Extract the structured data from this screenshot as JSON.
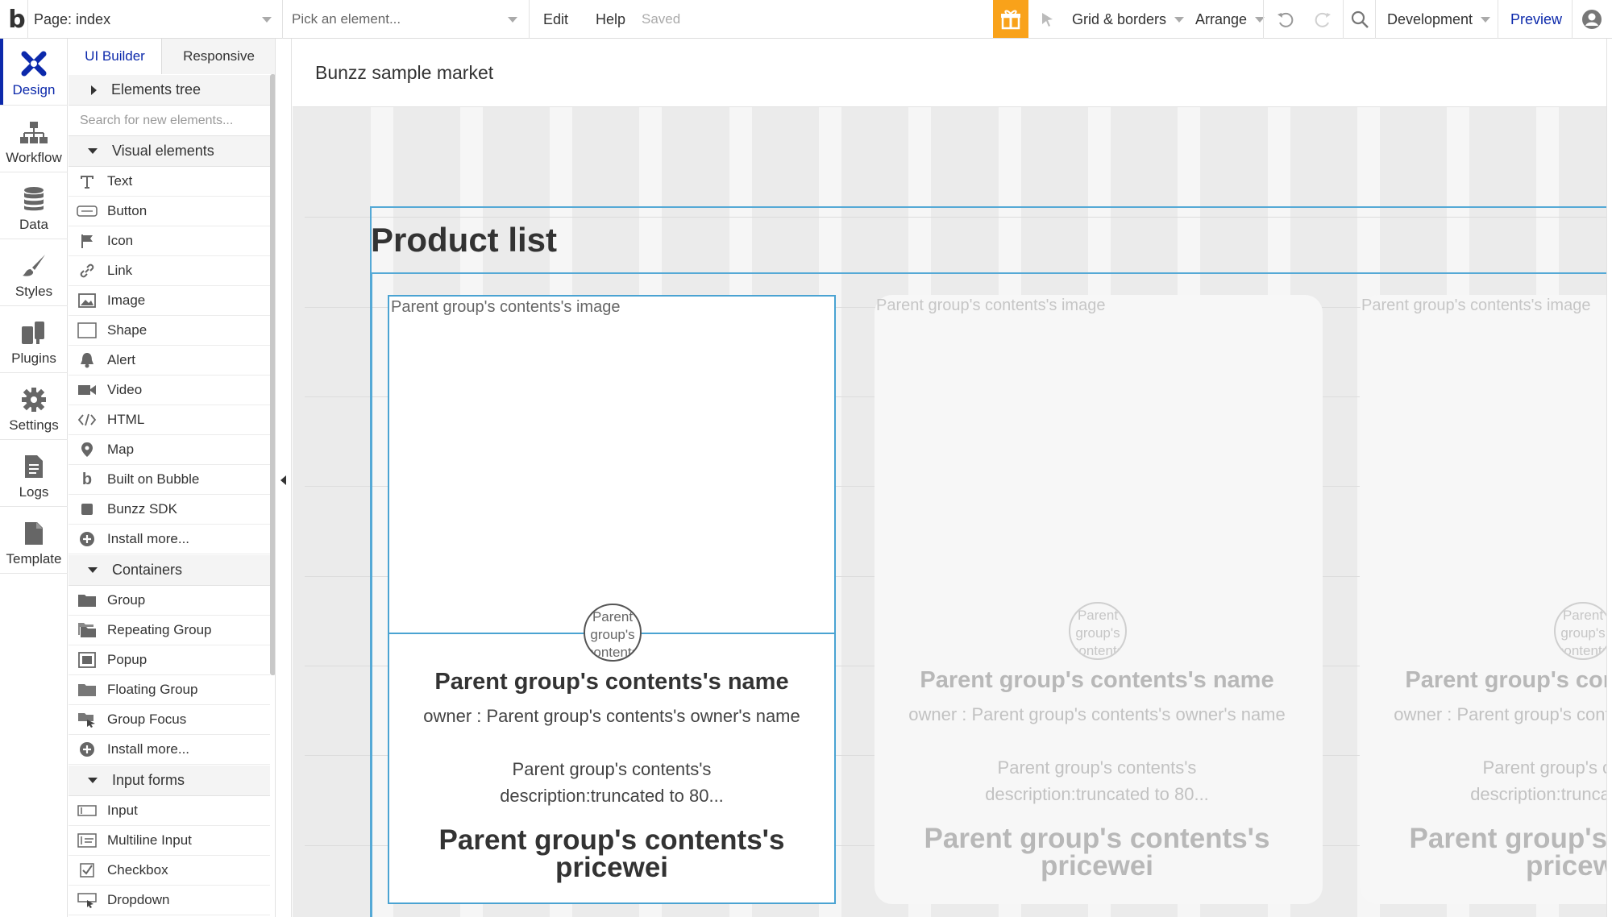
{
  "topbar": {
    "logo": "b",
    "page_label": "Page: index",
    "element_placeholder": "Pick an element...",
    "edit": "Edit",
    "help": "Help",
    "saved": "Saved",
    "grid_borders": "Grid & borders",
    "arrange": "Arrange",
    "environment": "Development",
    "preview": "Preview"
  },
  "leftnav": {
    "items": [
      {
        "label": "Design",
        "icon": "design-icon"
      },
      {
        "label": "Workflow",
        "icon": "workflow-icon"
      },
      {
        "label": "Data",
        "icon": "database-icon"
      },
      {
        "label": "Styles",
        "icon": "brush-icon"
      },
      {
        "label": "Plugins",
        "icon": "plugin-icon"
      },
      {
        "label": "Settings",
        "icon": "gear-icon"
      },
      {
        "label": "Logs",
        "icon": "document-icon"
      },
      {
        "label": "Template",
        "icon": "template-icon"
      }
    ]
  },
  "palette": {
    "tabs": [
      "UI Builder",
      "Responsive"
    ],
    "elements_tree": "Elements tree",
    "search_placeholder": "Search for new elements...",
    "sections": {
      "visual": "Visual elements",
      "containers": "Containers",
      "input": "Input forms"
    },
    "visual_items": [
      "Text",
      "Button",
      "Icon",
      "Link",
      "Image",
      "Shape",
      "Alert",
      "Video",
      "HTML",
      "Map",
      "Built on Bubble",
      "Bunzz SDK",
      "Install more..."
    ],
    "container_items": [
      "Group",
      "Repeating Group",
      "Popup",
      "Floating Group",
      "Group Focus",
      "Install more..."
    ],
    "input_items": [
      "Input",
      "Multiline Input",
      "Checkbox",
      "Dropdown"
    ]
  },
  "canvas": {
    "page_title": "Bunzz sample market",
    "product_list_title": "Product list",
    "card": {
      "image_text": "Parent group's contents's image",
      "avatar_text": "Parent group's contents",
      "name": "Parent group's contents's name",
      "owner": "owner : Parent group's contents's owner's name",
      "description": "Parent group's contents's description:truncated to 80...",
      "price": "Parent group's contents's pricewei"
    }
  },
  "colors": {
    "accent": "#0c29ab",
    "gift": "#f9a21a",
    "selection": "#4aa3d2"
  }
}
